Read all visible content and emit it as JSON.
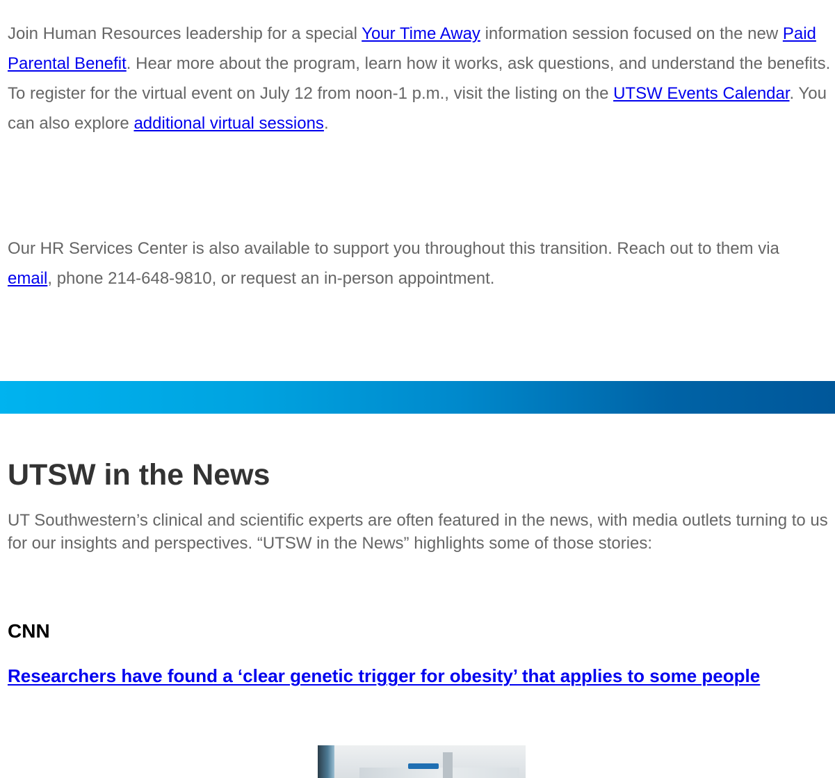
{
  "paragraph1": {
    "t1": "Join Human Resources leadership for a special ",
    "link1": "Your Time Away",
    "t2": " information session focused on the new ",
    "link2": "Paid Parental Benefit",
    "t3": ". Hear more about the program, learn how it works, ask questions, and understand the benefits. To register for the virtual event on July 12 from noon-1 p.m., visit the listing on the ",
    "link3": "UTSW Events Calendar",
    "t4": ". You can also explore ",
    "link4": "additional virtual sessions",
    "t5": "."
  },
  "paragraph2": {
    "t1": "Our HR Services Center is also available to support you throughout this transition. Reach out to them via ",
    "link1": "email",
    "t2": ", phone 214-648-9810, or request an in-person appointment."
  },
  "news": {
    "title": "UTSW in the News",
    "intro": "UT Southwestern’s clinical and scientific experts are often featured in the news, with media outlets turning to us for our insights and perspectives. “UTSW in the News” highlights some of those stories:",
    "items": [
      {
        "outlet": "CNN",
        "headline": "Researchers have found a ‘clear genetic trigger for obesity’ that applies to some people"
      }
    ]
  },
  "colors": {
    "body_text": "#666666",
    "link": "#0000ee",
    "gradient_start": "#00b3ef",
    "gradient_end": "#00579a"
  }
}
